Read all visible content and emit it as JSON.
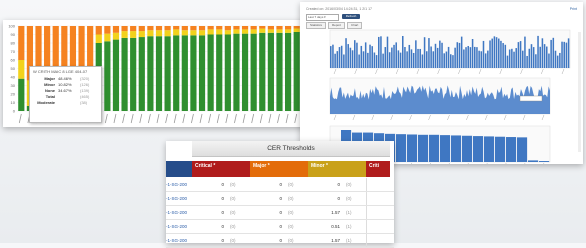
{
  "left_chart": {
    "chart_data": {
      "type": "bar",
      "stacked": true,
      "ylim": [
        0,
        100
      ],
      "yticks": [
        "100",
        "90",
        "80",
        "70",
        "60",
        "50",
        "40",
        "30",
        "20",
        "10",
        "0"
      ],
      "series": [
        {
          "color": "#2f8f2f",
          "values": [
            38,
            6,
            7,
            7,
            7,
            7,
            7,
            8,
            8,
            80,
            82,
            84,
            86,
            86,
            87,
            88,
            88,
            88,
            89,
            89,
            89,
            89,
            90,
            90,
            90,
            91,
            91,
            91,
            92,
            92,
            92,
            92,
            93
          ]
        },
        {
          "color": "#f2d21c",
          "values": [
            22,
            30,
            40,
            28,
            33,
            22,
            28,
            36,
            30,
            10,
            9,
            8,
            8,
            8,
            7,
            7,
            7,
            7,
            7,
            6,
            6,
            6,
            6,
            6,
            5,
            5,
            5,
            5,
            5,
            4,
            4,
            4,
            4
          ]
        },
        {
          "color": "#f58220",
          "values": [
            40,
            64,
            53,
            65,
            60,
            71,
            65,
            56,
            62,
            10,
            9,
            8,
            6,
            6,
            6,
            5,
            5,
            5,
            4,
            5,
            5,
            5,
            4,
            4,
            5,
            4,
            4,
            4,
            3,
            4,
            4,
            4,
            3
          ]
        }
      ]
    },
    "tooltip": {
      "title": "W CRITH MAIC 8 LGE 404-07",
      "rows": [
        {
          "key": "Major",
          "value": "48.46%",
          "count": "(320)"
        },
        {
          "key": "Minor",
          "value": "10.82%",
          "count": "(126)"
        },
        {
          "key": "None",
          "value": "34.67%",
          "count": "(139)"
        },
        {
          "key": "Total",
          "value": "",
          "count": "(465)"
        },
        {
          "key": "Moderate",
          "value": "",
          "count": "(38)"
        }
      ]
    }
  },
  "right_panel": {
    "header": "Created on: 2016/03/04 14:24:31, 1 2/1 17",
    "link": "Print",
    "select_value": "Last 7 days ▾",
    "button_label": "Refresh",
    "tabs": [
      "Statistics",
      "Report",
      "Chart"
    ],
    "charts": [
      {
        "type": "bar",
        "color": "#3f77c2"
      },
      {
        "type": "area",
        "color": "#4a7fc9"
      },
      {
        "type": "bar",
        "color": "#3f77c2",
        "values": [
          25,
          100,
          92,
          92,
          90,
          88,
          87,
          86,
          85,
          85,
          84,
          83,
          82,
          81,
          80,
          79,
          78,
          77,
          5,
          3
        ]
      }
    ]
  },
  "table": {
    "title": "CER Thresholds",
    "headers": {
      "critical": "Critical *",
      "major": "Major *",
      "minor": "Minor *",
      "crit2": "Criti"
    },
    "rows": [
      {
        "name": "-1-SG-200",
        "c1": "0",
        "n1": "(0)",
        "c2": "0",
        "n2": "(0)",
        "c3": "0",
        "n3": "(0)"
      },
      {
        "name": "-1-SG-200",
        "c1": "0",
        "n1": "(0)",
        "c2": "0",
        "n2": "(0)",
        "c3": "0",
        "n3": "(0)"
      },
      {
        "name": "-1-SG-200",
        "c1": "0",
        "n1": "(0)",
        "c2": "0",
        "n2": "(0)",
        "c3": "1.57",
        "n3": "(1)"
      },
      {
        "name": "-1-SG-200",
        "c1": "0",
        "n1": "(0)",
        "c2": "0",
        "n2": "(0)",
        "c3": "0.51",
        "n3": "(1)"
      },
      {
        "name": "-1-SG-200",
        "c1": "0",
        "n1": "(0)",
        "c2": "0",
        "n2": "(0)",
        "c3": "1.57",
        "n3": "(1)"
      }
    ]
  },
  "colors": {
    "green": "#2f8f2f",
    "yellow": "#f2d21c",
    "orange": "#f58220",
    "blue": "#3f77c2",
    "navy": "#264d8a"
  }
}
